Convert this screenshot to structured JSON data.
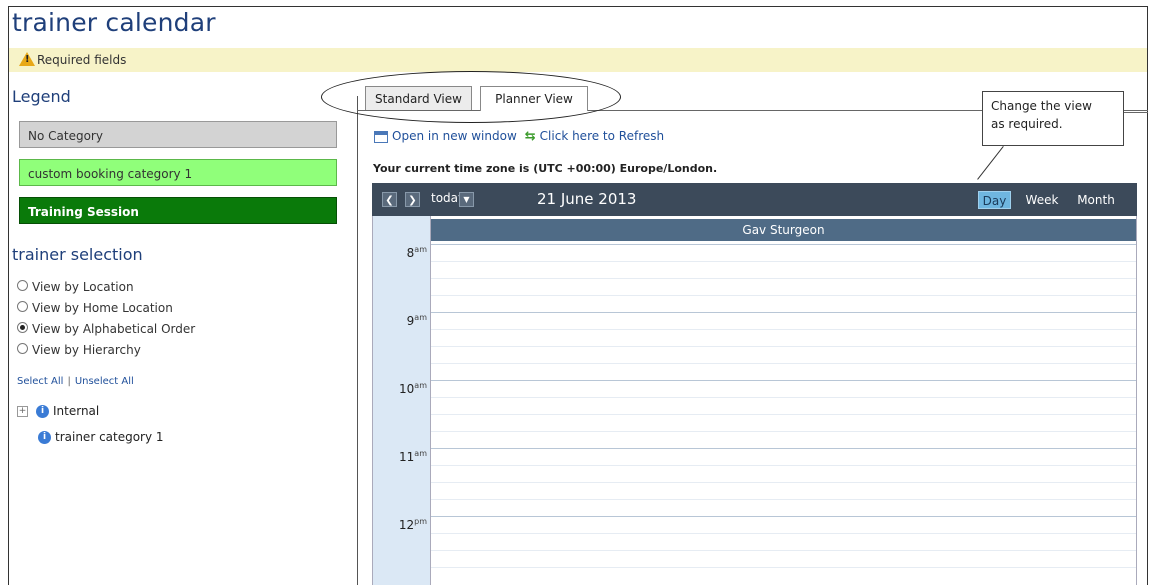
{
  "page": {
    "title": "trainer calendar"
  },
  "required": {
    "text": "Required fields",
    "icon": "warning-icon"
  },
  "legend": {
    "title": "Legend",
    "items": [
      {
        "label": "No Category",
        "color": "#d3d3d3"
      },
      {
        "label": "custom booking category 1",
        "color": "#90ff7a"
      },
      {
        "label": "Training Session",
        "color": "#0a7a0a"
      }
    ]
  },
  "trainer_selection": {
    "title": "trainer selection",
    "options": [
      {
        "label": "View by Location",
        "selected": false
      },
      {
        "label": "View by Home Location",
        "selected": false
      },
      {
        "label": "View by Alphabetical Order",
        "selected": true
      },
      {
        "label": "View by Hierarchy",
        "selected": false
      }
    ],
    "select_all": "Select All",
    "unselect_all": "Unselect All",
    "tree": [
      {
        "label": "Internal",
        "expandable": true
      },
      {
        "label": "trainer category 1",
        "expandable": false
      }
    ]
  },
  "tabs": [
    {
      "label": "Standard View",
      "active": false
    },
    {
      "label": "Planner View",
      "active": true
    }
  ],
  "links": {
    "open_new_window": "Open in new window",
    "refresh": "Click here to Refresh"
  },
  "timezone_text": "Your current time zone is (UTC +00:00) Europe/London.",
  "callout": {
    "line1": "Change the view",
    "line2": "as required."
  },
  "calendar": {
    "today_label": "today",
    "date": "21 June 2013",
    "views": {
      "day": "Day",
      "week": "Week",
      "month": "Month"
    },
    "active_view": "Day",
    "resource": "Gav Sturgeon",
    "hours": [
      {
        "num": "8",
        "suffix": "am"
      },
      {
        "num": "9",
        "suffix": "am"
      },
      {
        "num": "10",
        "suffix": "am"
      },
      {
        "num": "11",
        "suffix": "am"
      },
      {
        "num": "12",
        "suffix": "pm"
      }
    ]
  }
}
